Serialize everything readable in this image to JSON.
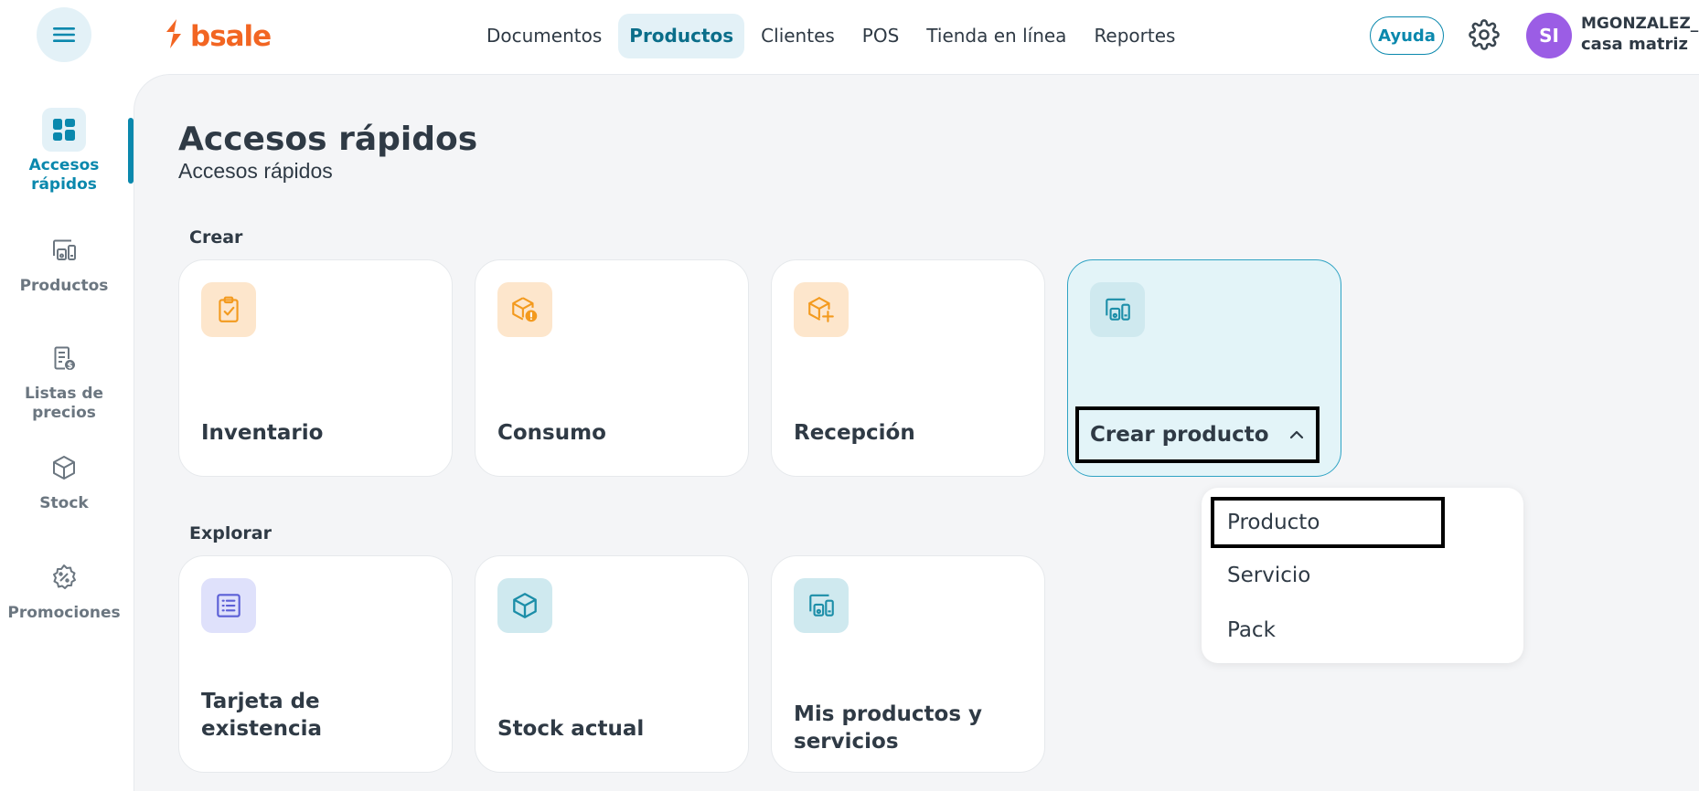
{
  "header": {
    "logo_text": "bsale",
    "nav": [
      {
        "label": "Documentos"
      },
      {
        "label": "Productos"
      },
      {
        "label": "Clientes"
      },
      {
        "label": "POS"
      },
      {
        "label": "Tienda en línea"
      },
      {
        "label": "Reportes"
      }
    ],
    "active_nav": "Productos",
    "help_label": "Ayuda",
    "avatar_initials": "SI",
    "user_name": "MGONZALEZ_...",
    "user_branch": "casa matriz"
  },
  "sidebar": {
    "items": [
      {
        "label": "Accesos rápidos",
        "icon": "dashboard-icon"
      },
      {
        "label": "Productos",
        "icon": "products-icon"
      },
      {
        "label": "Listas de precios",
        "icon": "price-list-icon"
      },
      {
        "label": "Stock",
        "icon": "box-icon"
      },
      {
        "label": "Promociones",
        "icon": "discount-badge-icon"
      }
    ],
    "active": "Accesos rápidos"
  },
  "page": {
    "title": "Accesos rápidos",
    "subtitle": "Accesos rápidos"
  },
  "sections": {
    "create_label": "Crear",
    "explore_label": "Explorar"
  },
  "create_cards": [
    {
      "title": "Inventario",
      "icon": "clipboard-check-icon"
    },
    {
      "title": "Consumo",
      "icon": "box-alert-icon"
    },
    {
      "title": "Recepción",
      "icon": "box-plus-icon"
    },
    {
      "title": "Crear producto",
      "icon": "products-icon"
    }
  ],
  "explore_cards": [
    {
      "title": "Tarjeta de existencia",
      "icon": "list-card-icon"
    },
    {
      "title": "Stock actual",
      "icon": "box-icon"
    },
    {
      "title": "Mis productos y servicios",
      "icon": "products-icon"
    }
  ],
  "dropdown": {
    "options": [
      "Producto",
      "Servicio",
      "Pack"
    ],
    "highlighted": "Producto"
  },
  "colors": {
    "accent": "#0a88ad",
    "brand": "#f26522",
    "avatar": "#9b5de5",
    "icon_orange": "#f39a1e",
    "icon_teal": "#1c8ea8",
    "icon_purple": "#5b5fd6"
  }
}
